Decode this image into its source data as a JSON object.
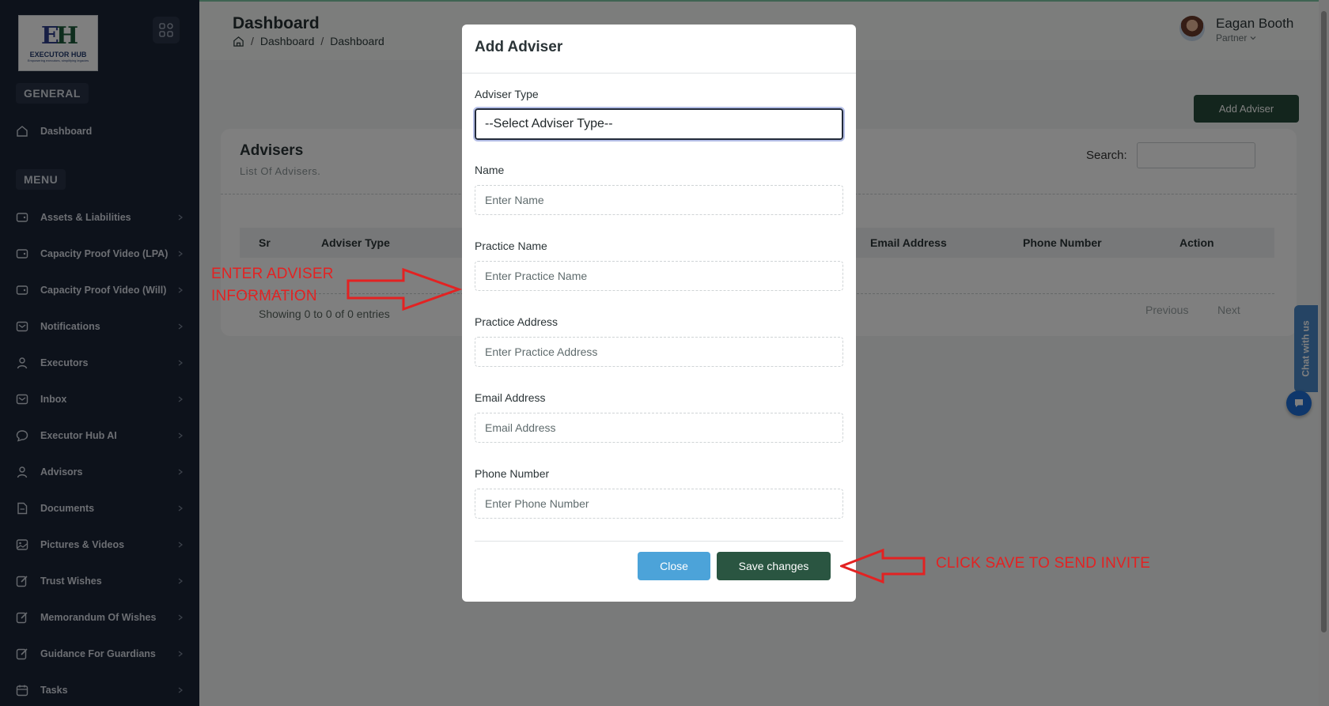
{
  "sidebar": {
    "logo": {
      "mark": "EH",
      "name": "EXECUTOR HUB",
      "tagline": "Empowering executors, simplifying legacies"
    },
    "section_general": "GENERAL",
    "section_menu": "MENU",
    "general_items": [
      {
        "label": "Dashboard",
        "icon": "home-icon"
      }
    ],
    "items": [
      {
        "label": "Assets & Liabilities",
        "icon": "wallet-icon"
      },
      {
        "label": "Capacity Proof Video (LPA)",
        "icon": "wallet-icon"
      },
      {
        "label": "Capacity Proof Video (Will)",
        "icon": "wallet-icon"
      },
      {
        "label": "Notifications",
        "icon": "mail-icon"
      },
      {
        "label": "Executors",
        "icon": "user-icon"
      },
      {
        "label": "Inbox",
        "icon": "mail-icon"
      },
      {
        "label": "Executor Hub AI",
        "icon": "chat-icon"
      },
      {
        "label": "Advisors",
        "icon": "user-icon"
      },
      {
        "label": "Documents",
        "icon": "document-icon"
      },
      {
        "label": "Pictures & Videos",
        "icon": "image-icon"
      },
      {
        "label": "Trust Wishes",
        "icon": "edit-icon"
      },
      {
        "label": "Memorandum Of Wishes",
        "icon": "edit-icon"
      },
      {
        "label": "Guidance For Guardians",
        "icon": "edit-icon"
      },
      {
        "label": "Tasks",
        "icon": "calendar-icon"
      }
    ]
  },
  "header": {
    "title": "Dashboard",
    "breadcrumb": [
      "Dashboard",
      "Dashboard"
    ],
    "breadcrumb_sep": "/",
    "user": {
      "name": "Eagan Booth",
      "role": "Partner"
    }
  },
  "main": {
    "add_button": "Add Adviser",
    "card": {
      "title": "Advisers",
      "subtitle": "List Of Advisers.",
      "search_label": "Search:",
      "columns": [
        "Sr",
        "Adviser Type",
        "Email Address",
        "Phone Number",
        "Action"
      ],
      "entries_info": "Showing 0 to 0 of 0 entries",
      "pager": {
        "previous": "Previous",
        "next": "Next"
      }
    }
  },
  "chat": {
    "label": "Chat with us"
  },
  "modal": {
    "title": "Add Adviser",
    "adviser_type": {
      "label": "Adviser Type",
      "value": "--Select Adviser Type--"
    },
    "name": {
      "label": "Name",
      "placeholder": "Enter Name"
    },
    "practice_name": {
      "label": "Practice Name",
      "placeholder": "Enter Practice Name"
    },
    "practice_address": {
      "label": "Practice Address",
      "placeholder": "Enter Practice Address"
    },
    "email": {
      "label": "Email Address",
      "placeholder": "Email Address"
    },
    "phone": {
      "label": "Phone Number",
      "placeholder": "Enter Phone Number"
    },
    "close_button": "Close",
    "save_button": "Save changes"
  },
  "annotations": {
    "enter_info_line1": "ENTER ADVISER",
    "enter_info_line2": "INFORMATION",
    "click_save": "CLICK SAVE TO SEND INVITE",
    "color": "#e32222"
  },
  "colors": {
    "sidebar_bg": "#1b2537",
    "primary_green": "#264b3a",
    "close_blue": "#4ca3d9",
    "chat_blue": "#1e6fd6"
  }
}
